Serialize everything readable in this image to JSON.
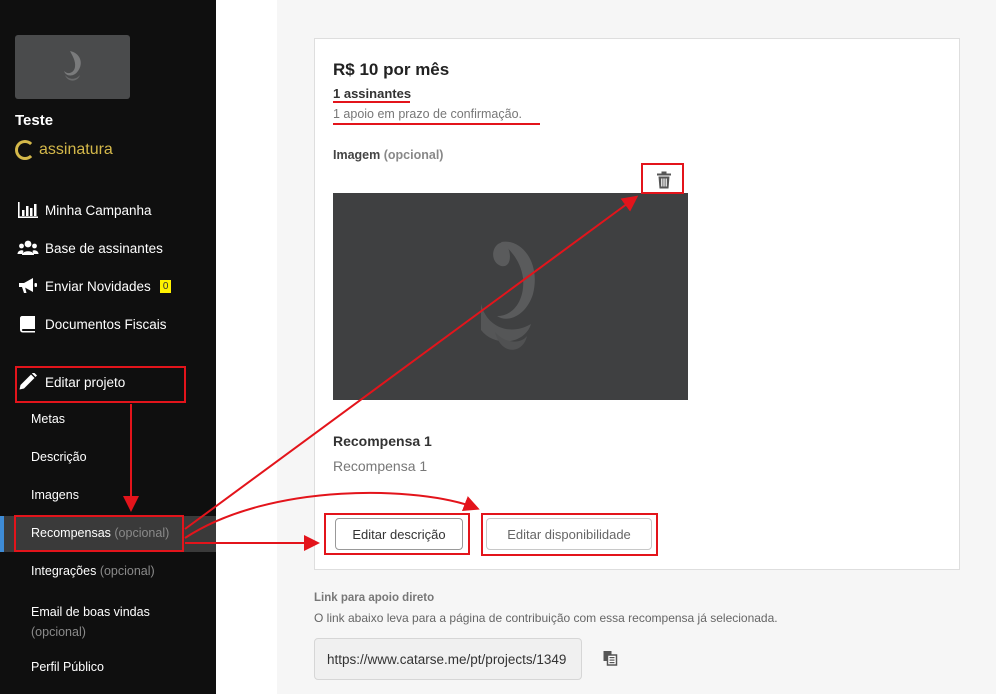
{
  "sidebar": {
    "project_name": "Teste",
    "brand": "assinatura",
    "nav": [
      {
        "label": "Minha Campanha",
        "icon": "bar-chart-icon"
      },
      {
        "label": "Base de assinantes",
        "icon": "users-icon"
      },
      {
        "label": "Enviar Novidades",
        "icon": "megaphone-icon",
        "badge": "0"
      },
      {
        "label": "Documentos Fiscais",
        "icon": "book-icon"
      },
      {
        "label": "Editar projeto",
        "icon": "pencil-icon"
      }
    ],
    "sub": {
      "metas": "Metas",
      "descricao": "Descrição",
      "imagens": "Imagens",
      "recompensas": "Recompensas",
      "recompensas_opt": "(opcional)",
      "integracoes": "Integrações",
      "integracoes_opt": "(opcional)",
      "email": "Email de boas vindas",
      "email_opt": "(opcional)",
      "perfil": "Perfil Público"
    }
  },
  "reward": {
    "price": "R$ 10 por mês",
    "subscribers": "1 assinantes",
    "pending": "1 apoio em prazo de confirmação.",
    "image_label": "Imagem",
    "image_optional": "(opcional)",
    "title": "Recompensa 1",
    "description": "Recompensa 1",
    "edit_description": "Editar descrição",
    "edit_availability": "Editar disponibilidade"
  },
  "direct_link": {
    "title": "Link para apoio direto",
    "description": "O link abaixo leva para a página de contribuição com essa recompensa já selecionada.",
    "url": "https://www.catarse.me/pt/projects/1349"
  },
  "colors": {
    "annotation": "#e3141b",
    "active_indicator": "#3e8bd6",
    "brand": "#d4b84a"
  }
}
